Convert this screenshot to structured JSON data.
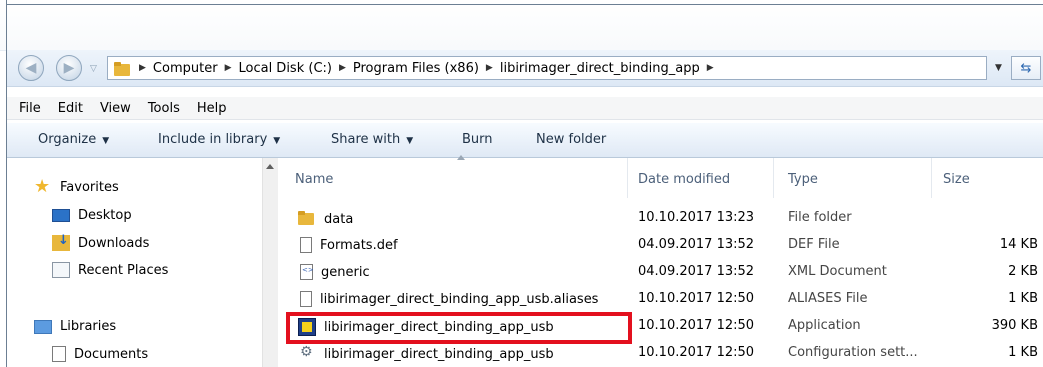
{
  "address_bar": {
    "breadcrumbs": [
      "Computer",
      "Local Disk (C:)",
      "Program Files (x86)",
      "libirimager_direct_binding_app"
    ]
  },
  "menu": [
    "File",
    "Edit",
    "View",
    "Tools",
    "Help"
  ],
  "toolbar": {
    "organize": "Organize",
    "include_library": "Include in library",
    "share_with": "Share with",
    "burn": "Burn",
    "new_folder": "New folder"
  },
  "sidebar": {
    "favorites": "Favorites",
    "items": [
      "Desktop",
      "Downloads",
      "Recent Places"
    ],
    "libraries": "Libraries",
    "library_items": [
      "Documents"
    ]
  },
  "columns": [
    "Name",
    "Date modified",
    "Type",
    "Size"
  ],
  "files": [
    {
      "name": "data",
      "date": "10.10.2017 13:23",
      "type": "File folder",
      "size": "",
      "icon": "folder-icon"
    },
    {
      "name": "Formats.def",
      "date": "04.09.2017 13:52",
      "type": "DEF File",
      "size": "14 KB",
      "icon": "file-icon"
    },
    {
      "name": "generic",
      "date": "04.09.2017 13:52",
      "type": "XML Document",
      "size": "2 KB",
      "icon": "xml-file-icon"
    },
    {
      "name": "libirimager_direct_binding_app_usb.aliases",
      "date": "10.10.2017 12:50",
      "type": "ALIASES File",
      "size": "1 KB",
      "icon": "file-icon"
    },
    {
      "name": "libirimager_direct_binding_app_usb",
      "date": "10.10.2017 12:50",
      "type": "Application",
      "size": "390 KB",
      "icon": "application-icon"
    },
    {
      "name": "libirimager_direct_binding_app_usb",
      "date": "10.10.2017 12:50",
      "type": "Configuration sett...",
      "size": "1 KB",
      "icon": "config-file-icon"
    }
  ],
  "colors": {
    "highlight_box": "#e3101e",
    "header_text": "#4c607a"
  }
}
